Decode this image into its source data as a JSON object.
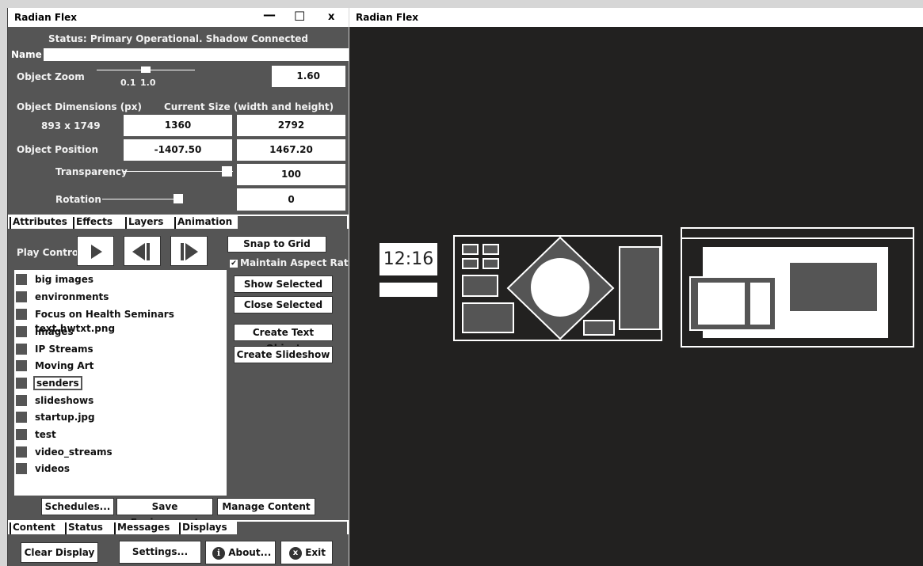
{
  "left_window": {
    "title": "Radian Flex",
    "controls": {
      "minimize": "—",
      "maximize": "☐",
      "close": "x"
    },
    "status": "Status: Primary Operational. Shadow Connected",
    "name_label": "Name",
    "name_value": "",
    "object_zoom": {
      "label": "Object Zoom",
      "min_label": "0.1",
      "max_label": "1.0",
      "value": "1.60"
    },
    "dimensions": {
      "label": "Object Dimensions (px)",
      "current_label": "Current Size (width and height)",
      "original": "893 x 1749",
      "width": "1360",
      "height": "2792"
    },
    "position": {
      "label": "Object Position",
      "x": "-1407.50",
      "y": "1467.20"
    },
    "transparency": {
      "label": "Transparency",
      "value": "100",
      "level": 1.0
    },
    "rotation": {
      "label": "Rotation",
      "value": "0"
    },
    "tabs_top": [
      {
        "label": "Attributes"
      },
      {
        "label": "Effects"
      },
      {
        "label": "Layers"
      },
      {
        "label": "Animation"
      }
    ],
    "play_control_label": "Play Control",
    "snap_to_grid": "Snap to Grid",
    "maintain_aspect_ratio": {
      "label": "Maintain Aspect Ratio",
      "checked": true
    },
    "layers": [
      {
        "label": "big images"
      },
      {
        "label": "environments"
      },
      {
        "label": "Focus on Health Seminars text.hwtxt.png"
      },
      {
        "label": "images"
      },
      {
        "label": "IP Streams"
      },
      {
        "label": "Moving Art"
      },
      {
        "label": "senders"
      },
      {
        "label": "slideshows"
      },
      {
        "label": "startup.jpg"
      },
      {
        "label": "test"
      },
      {
        "label": "video_streams"
      },
      {
        "label": "videos"
      }
    ],
    "selected_layer": "senders",
    "buttons": {
      "show_selected": "Show Selected",
      "close_selected": "Close Selected",
      "create_text_object": "Create Text Object",
      "create_slideshow": "Create Slideshow",
      "schedules": "Schedules...",
      "save_environment": "Save Environment",
      "manage_content": "Manage Content",
      "clear_display": "Clear Display",
      "settings": "Settings...",
      "about": "About...",
      "exit": "Exit"
    },
    "tabs_bottom": [
      {
        "label": "Content"
      },
      {
        "label": "Status"
      },
      {
        "label": "Messages"
      },
      {
        "label": "Displays"
      }
    ]
  },
  "right_window": {
    "title": "Radian Flex",
    "clock": "12:16"
  },
  "colors": {
    "panel": "#555555",
    "canvas": "#222120",
    "white": "#ffffff"
  }
}
